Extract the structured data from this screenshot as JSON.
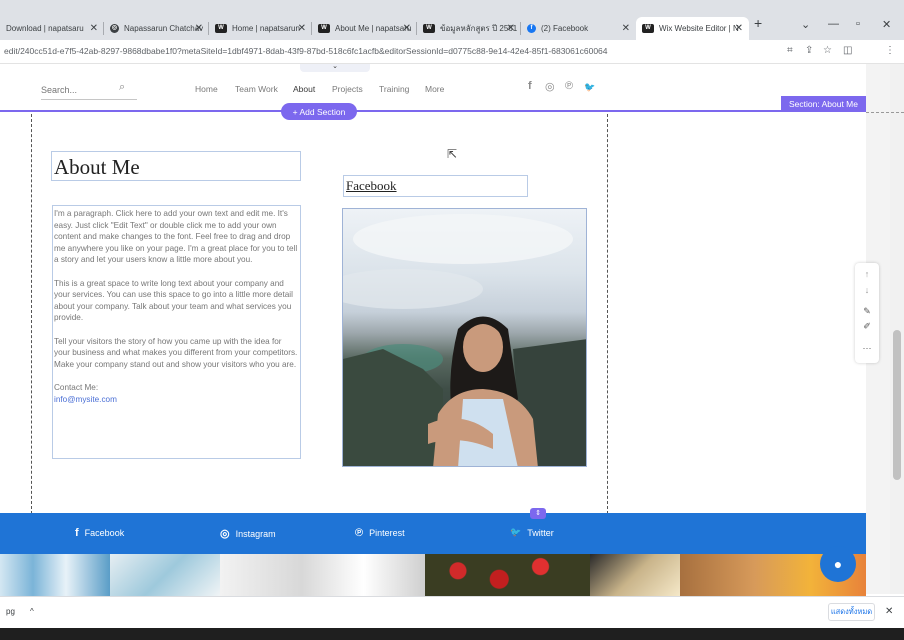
{
  "browser": {
    "tabs": [
      {
        "label": "Download | napatsaru",
        "favicon": "download-icon"
      },
      {
        "label": "Napassarun Chatchav",
        "favicon": "wix-icon"
      },
      {
        "label": "Home | napatsarun",
        "favicon": "wix-icon"
      },
      {
        "label": "About Me | napatsaru",
        "favicon": "wix-icon"
      },
      {
        "label": "ข้อมูลหลักสูตร ปี 2561 |",
        "favicon": "wix-icon"
      },
      {
        "label": "(2) Facebook",
        "favicon": "facebook-icon"
      },
      {
        "label": "Wix Website Editor | N",
        "favicon": "wix-icon",
        "active": true
      }
    ],
    "new_tab": "+",
    "url": "edit/240cc51d-e7f5-42ab-8297-9868dbabe1f0?metaSiteId=1dbf4971-8dab-43f9-87bd-518c6fc1acfb&editorSessionId=d0775c88-9e14-42e4-85f1-683061c60064",
    "window_controls": {
      "chevron": "⌄",
      "minimize": "—",
      "restore": "▫",
      "close": "✕"
    }
  },
  "site": {
    "search": {
      "placeholder": "Search..."
    },
    "nav": [
      "Home",
      "Team Work",
      "About",
      "Projects",
      "Training",
      "More"
    ],
    "nav_active": "About",
    "social_icons": [
      "f",
      "◎",
      "℗",
      "🐦"
    ]
  },
  "editor": {
    "section_label": "Section: About Me",
    "add_section": "+ Add Section"
  },
  "content": {
    "title": "About Me",
    "facebook_title": "Facebook",
    "paragraphs": [
      "I'm a paragraph. Click here to add your own text and edit me. It's easy. Just click \"Edit Text\" or double click me to add your own content and make changes to the font. Feel free to drag and drop me anywhere you like on your page. I'm a great place for you to tell a story and let your users know a little more about you.",
      "This is a great space to write long text about your company and your services. You can use this space to go into a little more detail about your company. Talk about your team and what services you provide.",
      "Tell your visitors the story of how you came up with the idea for your business and what makes you different from your competitors. Make your company stand out and show your visitors who you are."
    ],
    "contact_label": "Contact Me:",
    "contact_email": "info@mysite.com"
  },
  "footer": {
    "links": [
      {
        "label": "Facebook",
        "icon": "f"
      },
      {
        "label": "Instagram",
        "icon": "◎"
      },
      {
        "label": "Pinterest",
        "icon": "℗"
      },
      {
        "label": "Twitter",
        "icon": "🐦"
      }
    ]
  },
  "downloads": {
    "file_label": "pg",
    "chevron": "^",
    "show_all": "แสดงทั้งหมด",
    "close": "✕"
  },
  "colors": {
    "editor_accent": "#7c68ee",
    "footer_blue": "#1f74d6"
  }
}
